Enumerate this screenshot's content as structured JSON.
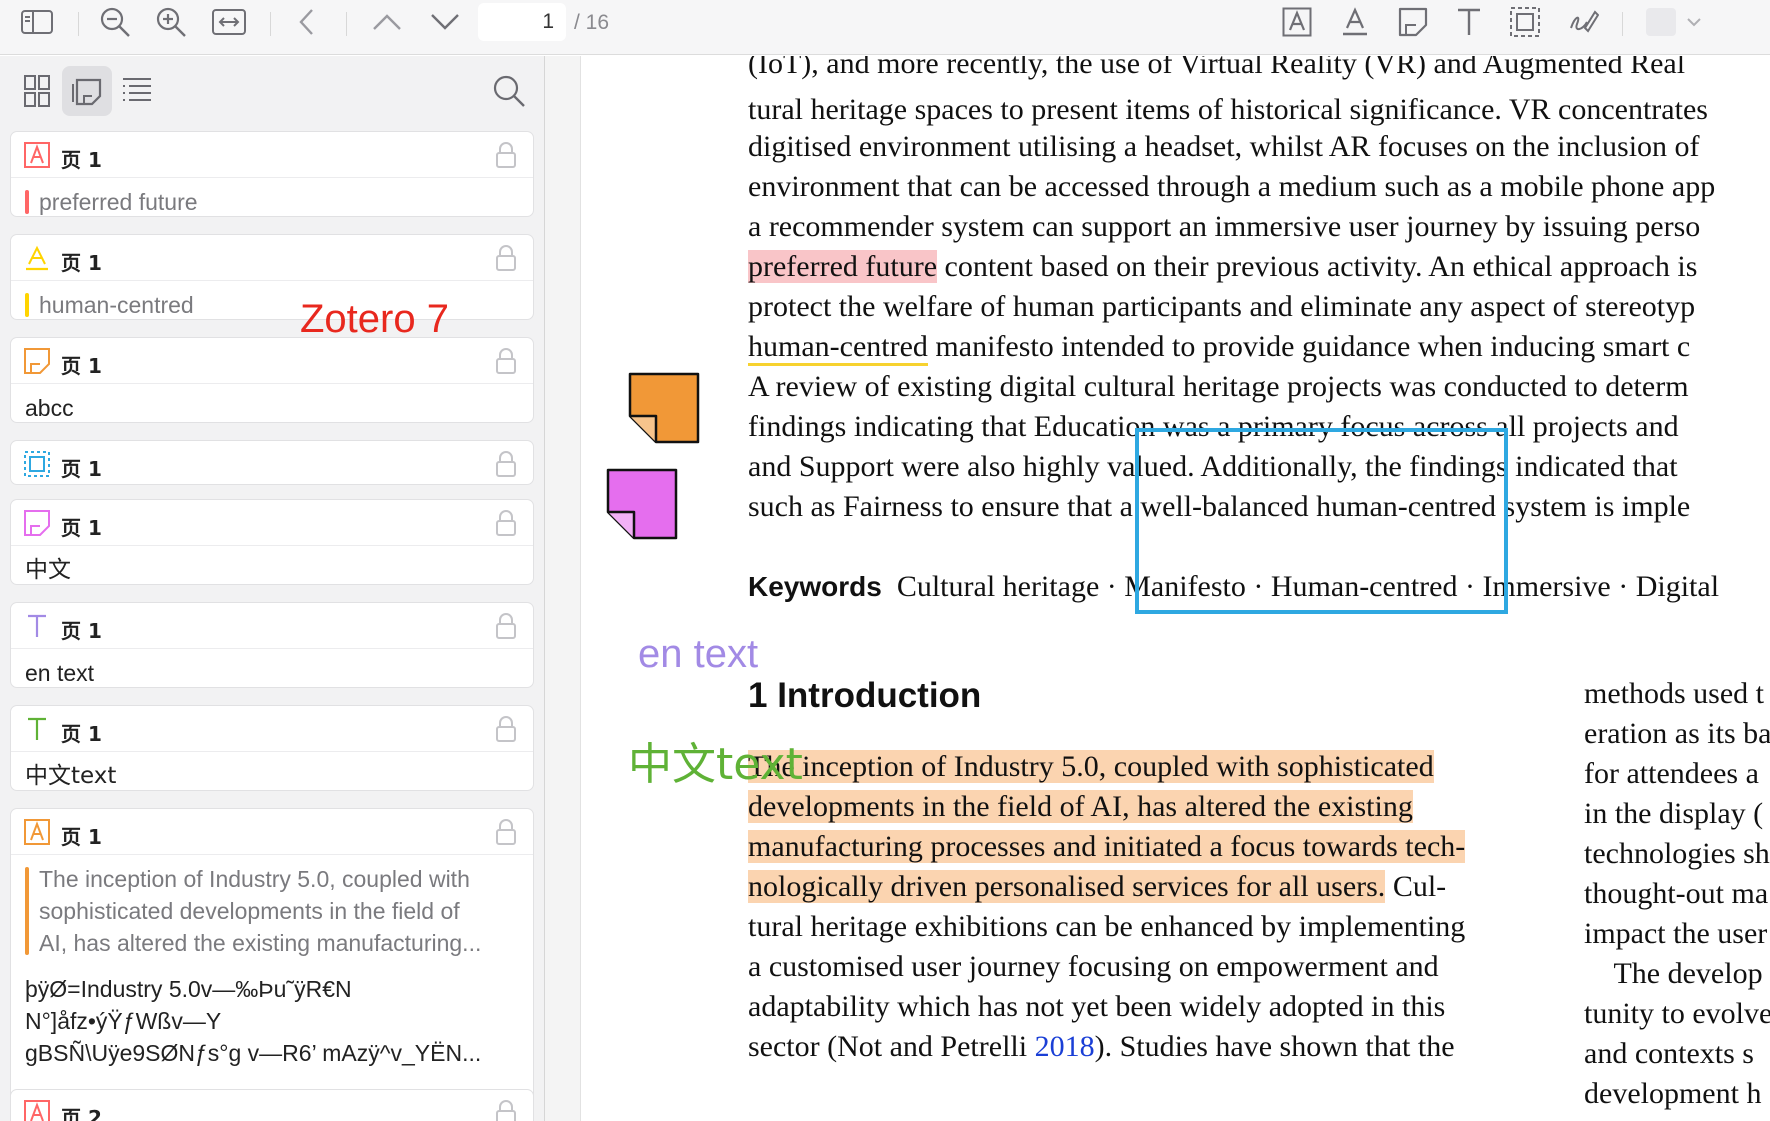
{
  "toolbar": {
    "page_current": "1",
    "page_total": "/ 16",
    "buttons": [
      "sidebar-toggle-icon",
      "zoom-out-icon",
      "zoom-in-icon",
      "zoom-fit-width-icon",
      "back-icon",
      "previous-page-icon",
      "next-page-icon",
      "highlight-tool-icon",
      "underline-tool-icon",
      "note-tool-icon",
      "text-tool-icon",
      "image-area-tool-icon",
      "ink-tool-icon",
      "color-picker"
    ],
    "colors": {
      "red": "#ff6666",
      "yellow": "#ffd400",
      "orange": "#f19837",
      "blue": "#2ea8e1",
      "magenta": "#e56eee",
      "purple": "#a28ae5",
      "green": "#5fb236"
    }
  },
  "sidebar": {
    "tabs": [
      "thumbnails-icon",
      "annotations-icon",
      "outline-icon"
    ],
    "search": "search-icon",
    "annotations": [
      {
        "type": "highlight",
        "color": "#ff6666",
        "page": "页 1",
        "quote": "preferred future",
        "comment": ""
      },
      {
        "type": "underline",
        "color": "#ffd400",
        "page": "页 1",
        "quote": "human-centred",
        "comment": ""
      },
      {
        "type": "note",
        "color": "#f19837",
        "page": "页 1",
        "quote": "",
        "comment": "abcc"
      },
      {
        "type": "image",
        "color": "#2ea8e1",
        "page": "页 1",
        "quote": "",
        "comment": ""
      },
      {
        "type": "note",
        "color": "#e56eee",
        "page": "页 1",
        "quote": "",
        "comment": "中文"
      },
      {
        "type": "text",
        "color": "#a28ae5",
        "page": "页 1",
        "quote": "",
        "comment": "en text"
      },
      {
        "type": "text",
        "color": "#5fb236",
        "page": "页 1",
        "quote": "",
        "comment": "中文text"
      },
      {
        "type": "highlight",
        "color": "#f19837",
        "page": "页 1",
        "quote_lines": [
          "The inception of Industry 5.0, coupled with",
          "sophisticated developments in the field of",
          "AI, has altered the existing manufacturing..."
        ],
        "comment_lines": [
          "þÿØ=Industry 5.0v—‰Þu˜ÿR€N",
          "N°]åfz•ýŸƒWßv—Y",
          "gBSÑ\\Uÿe9SØNƒs°g v—R6’ mAzÿ^v_YËN..."
        ]
      },
      {
        "type": "highlight",
        "color": "#ff6666",
        "page": "页 2",
        "quote": "",
        "comment": ""
      }
    ]
  },
  "overlay_label": "Zotero 7",
  "document": {
    "top_lines": [
      "(IoT), and more recently, the use of Virtual Reality (VR) and Augmented Real",
      "tural heritage spaces to present items of historical significance. VR concentrates",
      "digitised environment utilising a headset, whilst AR focuses on the inclusion of",
      "environment that can be accessed through a medium such as a mobile phone app",
      "a recommender system can support an immersive user journey by issuing perso"
    ],
    "line6": {
      "hl": "preferred future",
      "rest": " content based on their previous activity. An ethical approach is"
    },
    "line7": "protect the welfare of human participants and eliminate any aspect of stereotyp",
    "line8": {
      "ul": "human-centred",
      "rest": " manifesto intended to provide guidance when inducing smart c"
    },
    "after_lines": [
      "A review of existing digital cultural heritage projects was conducted to determ",
      "findings indicating that Education was a primary focus across all projects and",
      "and Support were also highly valued. Additionally, the findings indicated that",
      "such as Fairness to ensure that a well-balanced human-centred system is imple"
    ],
    "keywords_label": "Keywords",
    "keywords_text": "Cultural heritage · Manifesto · Human-centred · Immersive · Digital",
    "heading": "1  Introduction",
    "body_hl_lines": [
      "The inception of Industry 5.0, coupled with sophisticated",
      "developments in the field of AI, has altered the existing",
      "manufacturing processes and initiated a focus towards tech-"
    ],
    "line_hl_last": {
      "hl": "nologically driven personalised services for all users.",
      "rest": " Cul-"
    },
    "body_lines": [
      "tural heritage exhibitions can be enhanced by implementing",
      "a customised user journey focusing on empowerment and",
      "adaptability which has not yet been widely adopted in this"
    ],
    "cite_line": {
      "pre": "sector (Not and Petrelli ",
      "year": "2018",
      "post": "). Studies have shown that the"
    },
    "col2_lines": [
      "methods used t",
      "eration as its ba",
      "for attendees a",
      "in the display (",
      "technologies sh",
      "thought-out ma",
      "impact the user",
      "    The develop",
      "tunity to evolve",
      "and contexts s",
      "development h"
    ],
    "text_annotation_en": "en text",
    "text_annotation_zh": "中文text"
  }
}
